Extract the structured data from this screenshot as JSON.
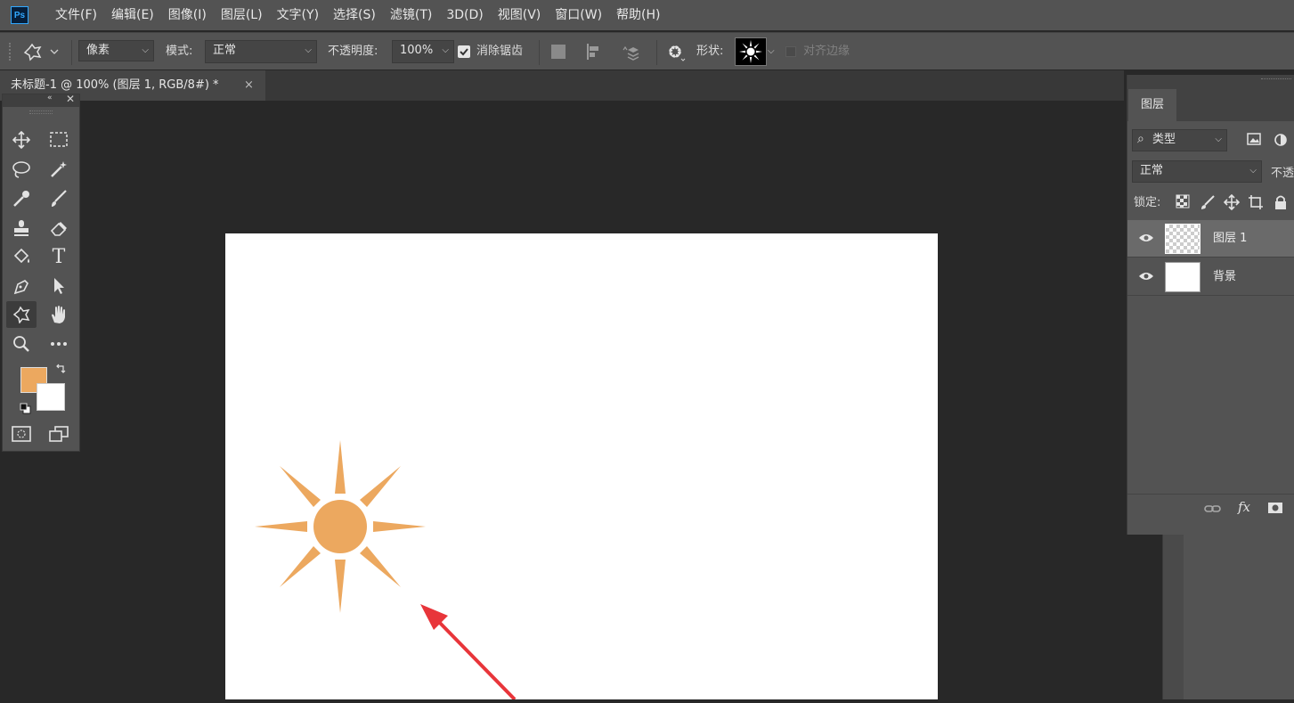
{
  "app": {
    "logo": "Ps"
  },
  "menu": [
    "文件(F)",
    "编辑(E)",
    "图像(I)",
    "图层(L)",
    "文字(Y)",
    "选择(S)",
    "滤镜(T)",
    "3D(D)",
    "视图(V)",
    "窗口(W)",
    "帮助(H)"
  ],
  "options": {
    "fill_mode": "像素",
    "mode_label": "模式:",
    "mode_value": "正常",
    "opacity_label": "不透明度:",
    "opacity_value": "100%",
    "antialias_label": "消除锯齿",
    "shape_label": "形状:",
    "align_edges_label": "对齐边缘"
  },
  "document": {
    "tab_title": "未标题-1 @ 100% (图层 1, RGB/8#) *",
    "close_glyph": "×"
  },
  "toolbox": {
    "foreground_color": "#eca85f",
    "background_color": "#ffffff"
  },
  "layers_panel": {
    "tab": "图层",
    "filter_label": "类型",
    "blend_mode": "正常",
    "opacity_label": "不透",
    "lock_label": "锁定:",
    "layers": [
      {
        "name": "图层 1",
        "selected": true,
        "transparent": true
      },
      {
        "name": "背景",
        "selected": false,
        "transparent": false
      }
    ],
    "fx_label": "fx"
  },
  "colors": {
    "shape_fill": "#eca85f",
    "arrow": "#e8353a",
    "accent": "#31a8ff"
  }
}
